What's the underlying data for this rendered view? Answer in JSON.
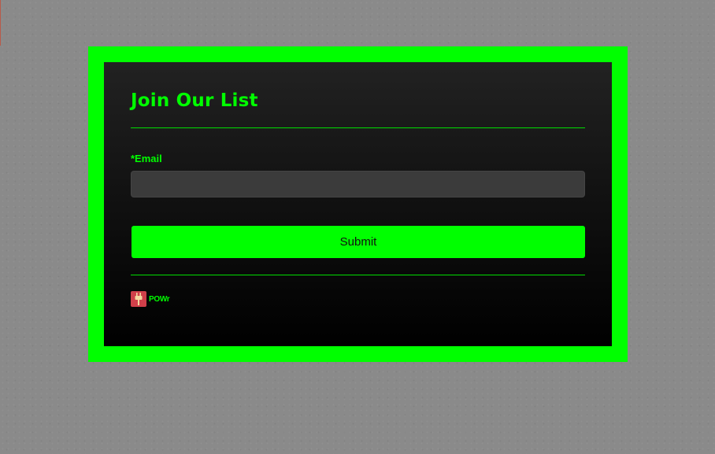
{
  "form": {
    "title": "Join Our List",
    "email_label": "*Email",
    "email_value": "",
    "email_placeholder": "",
    "submit_label": "Submit"
  },
  "footer": {
    "powered_by_text": "POWr",
    "logo_icon": "plug-icon"
  },
  "colors": {
    "accent": "#00ff00",
    "page_background": "#8a8a8a",
    "panel_background": "#000000",
    "input_background": "#3b3b3b",
    "logo_background": "#d0404a"
  }
}
